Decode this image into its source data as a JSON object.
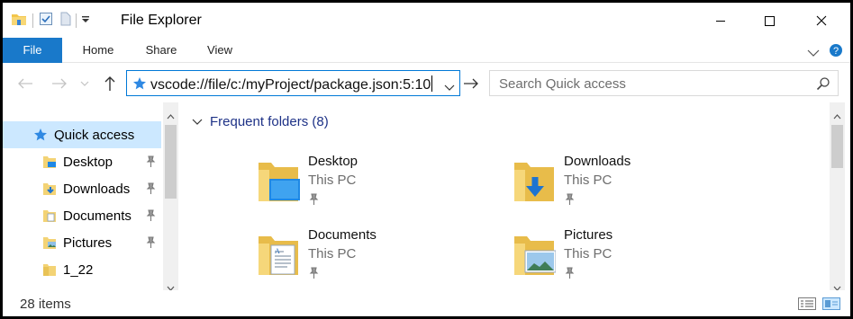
{
  "window": {
    "title": "File Explorer"
  },
  "ribbon": {
    "tabs": [
      {
        "label": "File"
      },
      {
        "label": "Home"
      },
      {
        "label": "Share"
      },
      {
        "label": "View"
      }
    ]
  },
  "address": {
    "value": "vscode://file/c:/myProject/package.json:5:10"
  },
  "search": {
    "placeholder": "Search Quick access"
  },
  "nav": {
    "items": [
      {
        "label": "Quick access",
        "icon": "star-icon",
        "pinned": false
      },
      {
        "label": "Desktop",
        "icon": "desktop-folder-icon",
        "pinned": true
      },
      {
        "label": "Downloads",
        "icon": "downloads-folder-icon",
        "pinned": true
      },
      {
        "label": "Documents",
        "icon": "documents-folder-icon",
        "pinned": true
      },
      {
        "label": "Pictures",
        "icon": "pictures-folder-icon",
        "pinned": true
      },
      {
        "label": "1_22",
        "icon": "folder-icon",
        "pinned": false
      }
    ]
  },
  "content": {
    "group_title": "Frequent folders (8)",
    "folders": [
      {
        "name": "Desktop",
        "location": "This PC"
      },
      {
        "name": "Downloads",
        "location": "This PC"
      },
      {
        "name": "Documents",
        "location": "This PC"
      },
      {
        "name": "Pictures",
        "location": "This PC"
      }
    ]
  },
  "status": {
    "item_count": "28 items"
  },
  "colors": {
    "accent": "#1979ca",
    "folder": "#f3d375",
    "selection": "#cce8ff",
    "group_header": "#1e3287"
  }
}
